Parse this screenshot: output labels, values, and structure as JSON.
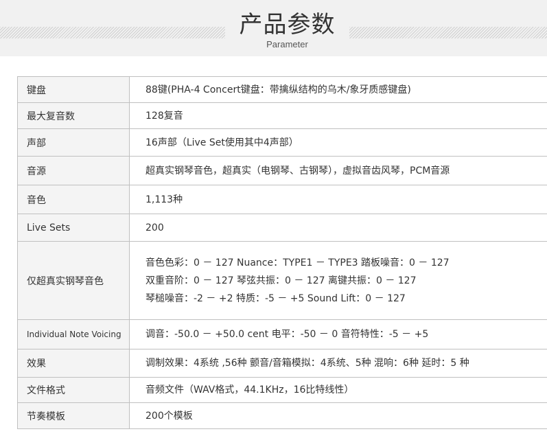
{
  "header": {
    "title": "产品参数",
    "subtitle": "Parameter"
  },
  "params": [
    {
      "label": "键盘",
      "values": [
        "88键(PHA-4 Concert键盘：带擒纵结构的乌木/象牙质感键盘)"
      ]
    },
    {
      "label": "最大复音数",
      "values": [
        "128复音"
      ]
    },
    {
      "label": "声部",
      "values": [
        "16声部（Live Set使用其中4声部）"
      ]
    },
    {
      "label": "音源",
      "values": [
        "超真实钢琴音色，超真实（电钢琴、古钢琴），虚拟音齿风琴，PCM音源"
      ]
    },
    {
      "label": "音色",
      "values": [
        "1,113种"
      ]
    },
    {
      "label": "Live Sets",
      "values": [
        "200"
      ]
    },
    {
      "label": "仅超真实钢琴音色",
      "values": [
        "音色色彩：0 － 127   Nuance：TYPE1 － TYPE3   踏板噪音：0 － 127",
        "双重音阶：0 － 127   琴弦共振：0 － 127   离键共振：0 － 127",
        "琴槌噪音：-2 － +2   特质：-5 － +5   Sound Lift：0 － 127"
      ]
    },
    {
      "label": "Individual Note Voicing",
      "values": [
        "调音：-50.0 － +50.0 cent   电平：-50 － 0   音符特性：-5 － +5"
      ]
    },
    {
      "label": "效果",
      "values": [
        "调制效果：4系统 ,56种   颤音/音箱模拟：4系统、5种   混响：6种   延时：5 种"
      ]
    },
    {
      "label": "文件格式",
      "values": [
        "音频文件（WAV格式，44.1KHz，16比特线性）"
      ]
    },
    {
      "label": "节奏模板",
      "values": [
        "200个模板"
      ]
    }
  ],
  "colors": {
    "banner_bg": "#f1f1f1",
    "label_bg": "#f4f4f4",
    "border": "#bfbfbf",
    "text": "#333333"
  }
}
